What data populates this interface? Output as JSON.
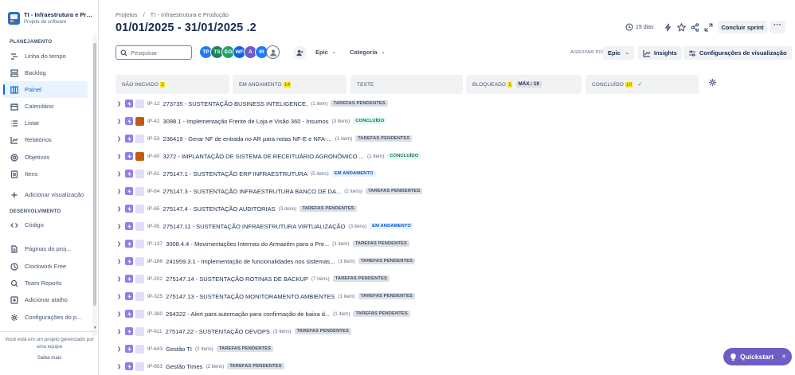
{
  "sidebar": {
    "project_name": "TI - Infraestrutura e Produção",
    "project_type": "Projeto de software",
    "planning_label": "PLANEJAMENTO",
    "development_label": "DESENVOLVIMENTO",
    "nav": {
      "timeline": "Linha do tempo",
      "backlog": "Backlog",
      "board": "Painel",
      "calendar": "Calendário",
      "list": "Listar",
      "reports": "Relatórios",
      "goals": "Objetivos",
      "items": "Itens",
      "add_view": "Adicionar visualização",
      "code": "Código",
      "project_pages": "Páginas do proj...",
      "clockwork": "Clockwork Free",
      "team_reports": "Team Reports",
      "add_shortcut": "Adicionar atalho",
      "project_settings": "Configurações do p..."
    },
    "managed_note": "Você está em um projeto gerenciado por uma equipe",
    "learn_more": "Saiba mais"
  },
  "header": {
    "breadcrumbs": [
      "Projetos",
      "/",
      "TI - Infraestrutura e Produção"
    ],
    "title": "01/01/2025 - 31/01/2025 .2",
    "days_left": "19 dias",
    "complete_sprint": "Concluir sprint",
    "more": "···"
  },
  "toolbar": {
    "search_placeholder": "Pesquisar",
    "avatars": [
      {
        "initials": "TP",
        "color": "#1d7afc"
      },
      {
        "initials": "TS",
        "color": "#1f845a"
      },
      {
        "initials": "EO",
        "color": "#22a06b"
      },
      {
        "initials": "WF",
        "color": "#0c66e4"
      },
      {
        "initials": "A",
        "color": "#6e5dc6"
      },
      {
        "initials": "IR",
        "color": "#1d7afc"
      }
    ],
    "epic_filter": "Epic",
    "category_filter": "Categoria",
    "group_by_label": "AGRUPAR POR",
    "group_by_value": "Epic",
    "insights": "Insights",
    "view_settings": "Configurações de visualização"
  },
  "columns": {
    "todo": {
      "label": "NÃO INICIADO",
      "count": "3"
    },
    "inprogress": {
      "label": "EM ANDAMENTO",
      "count": "14"
    },
    "test": {
      "label": "TESTE"
    },
    "blocked": {
      "label": "BLOQUEADO",
      "count": "1",
      "max": "MÁX.: 10"
    },
    "done": {
      "label": "CONCLUÍDO",
      "count": "10"
    }
  },
  "epics": [
    {
      "key": "IP-12",
      "summary": "273735 - SUSTENTAÇÃO BUSINESS INTELIGENCE,",
      "items": "(1 item)",
      "status": "TAREFAS PENDENTES",
      "style": "todo",
      "tile": "light"
    },
    {
      "key": "IP-42",
      "summary": "3098.1 - Implementação Frente de Loja e Visão 360 - Insumos",
      "items": "(3 itens)",
      "status": "CONCLUÍDO",
      "style": "done",
      "tile": "orange"
    },
    {
      "key": "IP-53",
      "summary": "236419 - Gerar NF de entrada no AR para notas NF-E e NFA-...",
      "items": "(1 item)",
      "status": "TAREFAS PENDENTES",
      "style": "todo",
      "tile": "light"
    },
    {
      "key": "IP-60",
      "summary": "3272 - IMPLANTAÇÃO DE SISTEMA DE RECEITUÁRIO AGRONÔMICO ...",
      "items": "(1 item)",
      "status": "CONCLUÍDO",
      "style": "done",
      "tile": "orange"
    },
    {
      "key": "IP-61",
      "summary": "275147.1 - SUSTENTAÇÃO ERP INFRAESTRUTURA",
      "items": "(5 itens)",
      "status": "EM ANDAMENTO",
      "style": "prog",
      "tile": "light"
    },
    {
      "key": "IP-64",
      "summary": "275147.3 - SUSTENTAÇÃO INFRAESTRUTURA BANCO DE DA...",
      "items": "(2 itens)",
      "status": "TAREFAS PENDENTES",
      "style": "todo",
      "tile": "light"
    },
    {
      "key": "IP-65",
      "summary": "275147.4 - SUSTENTAÇÃO AUDITORIAS",
      "items": "(3 itens)",
      "status": "TAREFAS PENDENTES",
      "style": "todo",
      "tile": "light"
    },
    {
      "key": "IP-95",
      "summary": "275147.11 - SUSTENTAÇÃO INFRAESTRUTURA VIRTUALIZAÇÃO",
      "items": "(3 itens)",
      "status": "EM ANDAMENTO",
      "style": "prog",
      "tile": "light"
    },
    {
      "key": "IP-137",
      "summary": "3008.4.4 - Movimentações Internas do Armazém para o Pre...",
      "items": "(1 item)",
      "status": "TAREFAS PENDENTES",
      "style": "todo",
      "tile": "light"
    },
    {
      "key": "IP-186",
      "summary": "241959.3.1 - Implementação de funcionalidades nos sistemas...",
      "items": "(1 item)",
      "status": "TAREFAS PENDENTES",
      "style": "todo",
      "tile": "light"
    },
    {
      "key": "IP-202",
      "summary": "275147.14 - SUSTENTAÇÃO ROTINAS DE BACKUP",
      "items": "(7 itens)",
      "status": "TAREFAS PENDENTES",
      "style": "todo",
      "tile": "light"
    },
    {
      "key": "IP-325",
      "summary": "275147.13 - SUSTENTAÇÃO MONITORAMENTO AMBIENTES",
      "items": "(1 item)",
      "status": "TAREFAS PENDENTES",
      "style": "todo",
      "tile": "light"
    },
    {
      "key": "IP-380",
      "summary": "264322 - Alert para automação para confirmação de baixa d...",
      "items": "(1 item)",
      "status": "TAREFAS PENDENTES",
      "style": "todo",
      "tile": "light"
    },
    {
      "key": "IP-611",
      "summary": "275147.22 - SUSTENTAÇÃO DEVOPS",
      "items": "(3 itens)",
      "status": "TAREFAS PENDENTES",
      "style": "todo",
      "tile": "light"
    },
    {
      "key": "IP-643",
      "summary": "Gestão TI",
      "items": "(2 itens)",
      "status": "TAREFAS PENDENTES",
      "style": "todo",
      "tile": "light"
    },
    {
      "key": "IP-653",
      "summary": "Gestão Times",
      "items": "(2 itens)",
      "status": "TAREFAS PENDENTES",
      "style": "todo",
      "tile": "light"
    }
  ],
  "quickstart": {
    "label": "Quickstart",
    "close": "✕"
  }
}
